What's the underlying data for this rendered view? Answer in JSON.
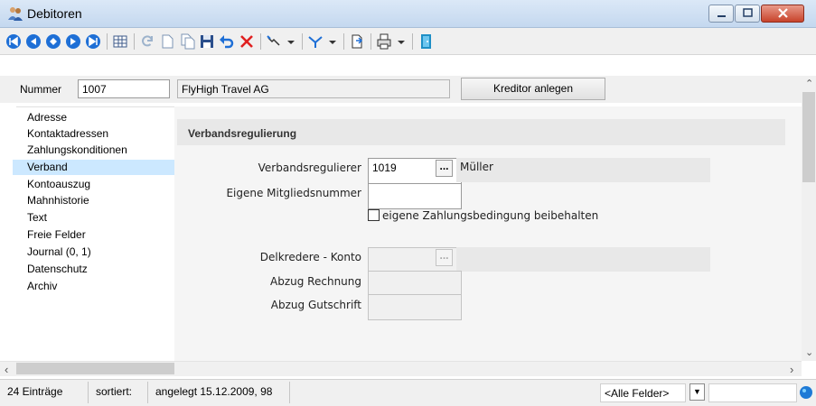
{
  "window": {
    "title": "Debitoren"
  },
  "toolbar": {
    "icons": [
      "first-record-icon",
      "previous-record-icon",
      "next-record-icon",
      "next-page-icon",
      "last-record-icon",
      "table-view-icon",
      "refresh-icon",
      "new-document-icon",
      "copy-icon",
      "save-icon",
      "undo-icon",
      "delete-icon",
      "tools-icon",
      "filter-icon",
      "export-icon",
      "print-icon",
      "exit-icon"
    ]
  },
  "header": {
    "number_label": "Nummer",
    "number_value": "1007",
    "name_value": "FlyHigh Travel AG",
    "kreditor_button": "Kreditor anlegen"
  },
  "nav": {
    "items": [
      {
        "label": "Adresse"
      },
      {
        "label": "Kontaktadressen"
      },
      {
        "label": "Zahlungskonditionen"
      },
      {
        "label": "Verband",
        "selected": true
      },
      {
        "label": "Kontoauszug"
      },
      {
        "label": "Mahnhistorie"
      },
      {
        "label": "Text"
      },
      {
        "label": "Freie Felder"
      },
      {
        "label": "Journal (0, 1)"
      },
      {
        "label": "Datenschutz"
      },
      {
        "label": "Archiv"
      }
    ]
  },
  "form": {
    "section_title": "Verbandsregulierung",
    "verbandsregulierer_label": "Verbandsregulierer",
    "verbandsregulierer_value": "1019",
    "verbandsregulierer_name": "Müller",
    "mitgliedsnummer_label": "Eigene Mitgliedsnummer",
    "mitgliedsnummer_value": "",
    "checkbox_label": "eigene Zahlungsbedingung beibehalten",
    "checkbox_checked": false,
    "delkredere_label": "Delkredere - Konto",
    "abzug_rechnung_label": "Abzug Rechnung",
    "abzug_gutschrift_label": "Abzug Gutschrift",
    "lookup_button": "..."
  },
  "status": {
    "entries": "24 Einträge",
    "sorted": "sortiert:",
    "created": "angelegt 15.12.2009, 98",
    "filter": "<Alle Felder>"
  },
  "colors": {
    "title_bar": "#c4d8ef",
    "nav_selected": "#cce8ff",
    "close_button": "#c7432b",
    "section_header": "#e8e8e8"
  }
}
